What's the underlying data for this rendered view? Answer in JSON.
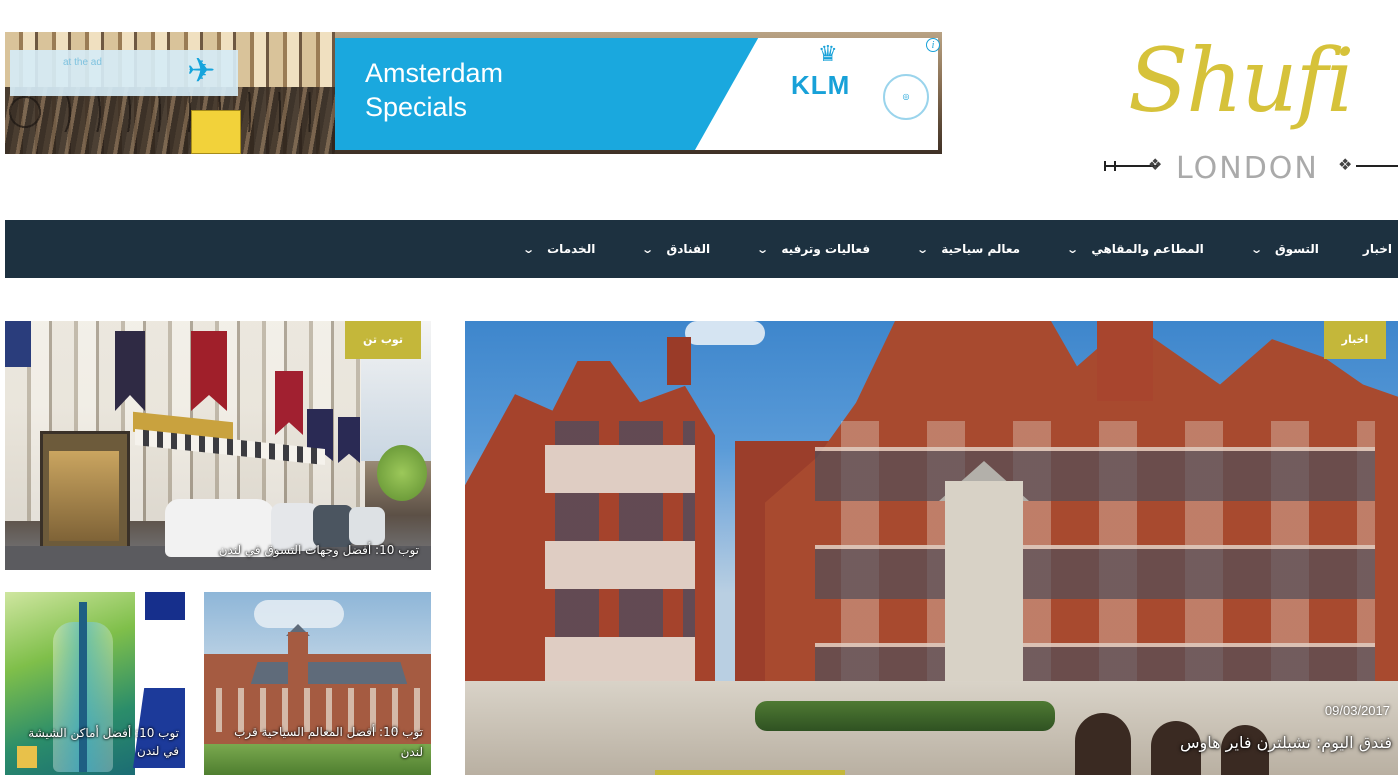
{
  "ad": {
    "headline_line1": "Amsterdam",
    "headline_line2": "Specials",
    "brand": "KLM",
    "small_text": "at the ad",
    "info_icon": "info-icon",
    "colors": {
      "blue": "#1aa8de",
      "white": "#ffffff",
      "sign": "#f2d23a"
    }
  },
  "logo": {
    "script": "Shufi",
    "city": "LONDON",
    "colors": {
      "script": "#d6c23a",
      "city": "#aaaaaa"
    }
  },
  "nav": {
    "background": "#1d3140",
    "items": [
      {
        "label": "اخبار",
        "has_dropdown": false
      },
      {
        "label": "التسوق",
        "has_dropdown": true
      },
      {
        "label": "المطاعم والمقاهي",
        "has_dropdown": true
      },
      {
        "label": "معالم سياحية",
        "has_dropdown": true
      },
      {
        "label": "فعاليات وترفيه",
        "has_dropdown": true
      },
      {
        "label": "الفنادق",
        "has_dropdown": true
      },
      {
        "label": "الخدمات",
        "has_dropdown": true
      }
    ],
    "chevron_icon": "chevron-down-icon"
  },
  "featured": {
    "badge": "اخبار",
    "date": "09/03/2017",
    "title": "فندق اليوم: تشيلترن فاير هاوس"
  },
  "tiles": {
    "street": {
      "badge": "توب تن",
      "caption": "توب 10: أفضل وجهات التسوق في لندن"
    },
    "shisha": {
      "caption": "توب 10: أفضل أماكن الشيشة في لندن"
    },
    "university": {
      "caption": "توب 10: أفضل المعالم السياحية قرب لندن"
    }
  },
  "accent_color": "#c4b73a"
}
